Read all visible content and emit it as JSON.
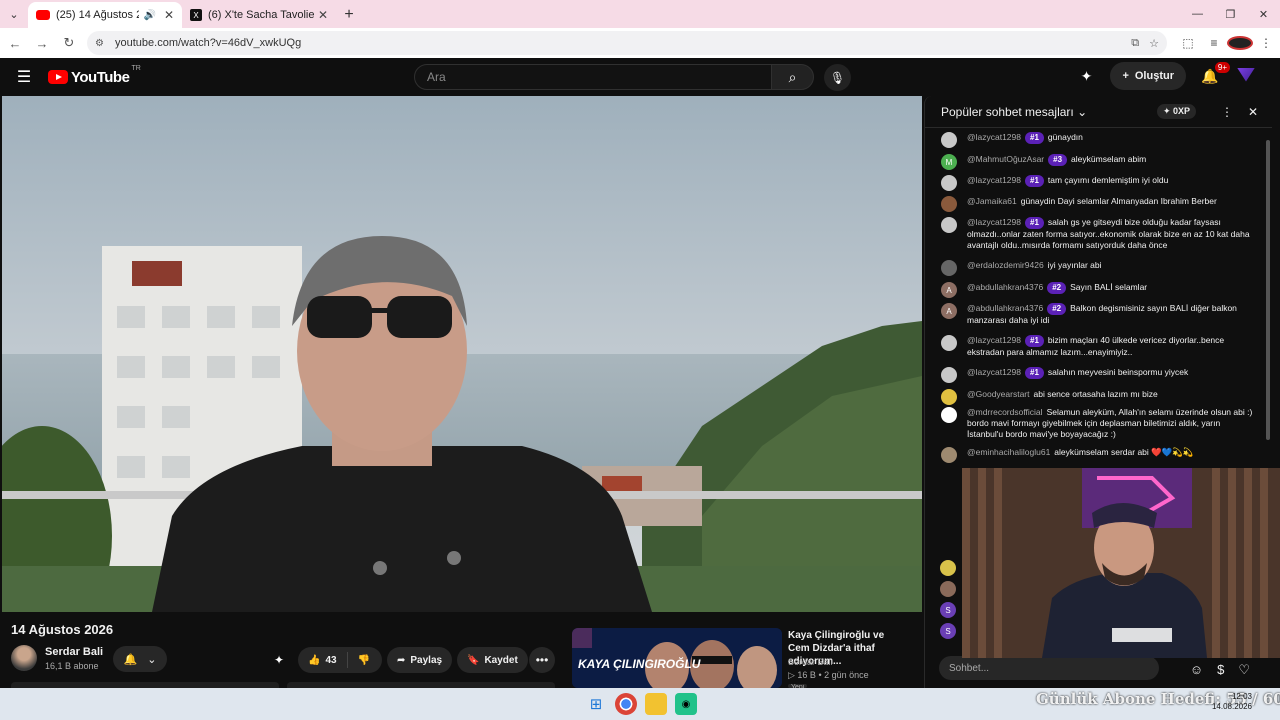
{
  "browser": {
    "tabs": [
      {
        "title": "(25) 14 Ağustos 2026 - You",
        "active": true
      },
      {
        "title": "(6) X'te Sacha Tavolieri: \"",
        "active": false
      }
    ],
    "url": "youtube.com/watch?v=46dV_xwkUQg"
  },
  "youtube": {
    "logo": "YouTube",
    "country": "TR",
    "search_placeholder": "Ara",
    "create_label": "Oluştur",
    "notification_count": "9+"
  },
  "video": {
    "title": "14 Ağustos 2026",
    "channel": "Serdar Bali",
    "subscribers": "16,1 B abone",
    "likes": "43",
    "share_label": "Paylaş",
    "save_label": "Kaydet"
  },
  "recommendation": {
    "thumb_text": "KAYA ÇILINGIROĞLU",
    "title": "Kaya Çilingiroğlu ve Cem Dizdar'a ithaf ediyorum...",
    "channel": "Serdar Bali",
    "views": "16 B",
    "age": "2 gün önce",
    "badge": "Yeni"
  },
  "chat": {
    "header_title": "Popüler sohbet mesajları",
    "xp_label": "0XP",
    "input_placeholder": "Sohbet...",
    "messages": [
      {
        "author": "@lazycat1298",
        "badge": "#1",
        "text": "günaydın",
        "color": "#c8c8c8"
      },
      {
        "author": "@MahmutOğuzAsar",
        "badge": "#3",
        "text": "aleykümselam abim",
        "color": "#4caf50",
        "initial": "M"
      },
      {
        "author": "@lazycat1298",
        "badge": "#1",
        "text": "tam çayımı demlemiştim iyi oldu",
        "color": "#c8c8c8"
      },
      {
        "author": "@Jamaika61",
        "badge": "",
        "text": "günaydin Dayi selamlar Almanyadan Ibrahim Berber",
        "color": "#8a5a3c"
      },
      {
        "author": "@lazycat1298",
        "badge": "#1",
        "text": "salah gs ye gitseydi bize olduğu kadar faysası olmazdı..onlar zaten forma satıyor..ekonomik olarak bize en az 10 kat daha avantajlı oldu..mısırda formamı satıyorduk daha önce",
        "color": "#c8c8c8"
      },
      {
        "author": "@erdalozdemir9426",
        "badge": "",
        "text": "iyi yayınlar abi",
        "color": "#666"
      },
      {
        "author": "@abdullahkran4376",
        "badge": "#2",
        "text": "Sayın BALİ selamlar",
        "color": "#8d6e63",
        "initial": "A"
      },
      {
        "author": "@abdullahkran4376",
        "badge": "#2",
        "text": "Balkon degismisiniz sayın BALİ diğer balkon manzarası daha iyi idi",
        "color": "#8d6e63",
        "initial": "A"
      },
      {
        "author": "@lazycat1298",
        "badge": "#1",
        "text": "bizim maçları 40 ülkede vericez diyorlar..bence ekstradan para almamız lazım...enayimiyiz..",
        "color": "#c8c8c8"
      },
      {
        "author": "@lazycat1298",
        "badge": "#1",
        "text": "salahın meyvesini beinspormu yiycek",
        "color": "#c8c8c8"
      },
      {
        "author": "@Goodyearstart",
        "badge": "",
        "text": "abi sence ortasaha lazım mı bize",
        "color": "#e0c040"
      },
      {
        "author": "@mdrrecordsofficial",
        "badge": "",
        "text": "Selamun aleyküm, Allah'ın selamı üzerinde olsun abi :) bordo mavi formayı giyebilmek için deplasman biletimizi aldık, yarın İstanbul'u bordo mavi'ye boyayacağız :)",
        "color": "#ffffff"
      },
      {
        "author": "@eminhacihaliloglu61",
        "badge": "",
        "text": "aleykümselam serdar abi ❤️💙💫💫",
        "color": "#9e8a70"
      }
    ],
    "side_avatars": [
      "",
      "",
      "S",
      "S"
    ]
  },
  "overlay": {
    "goal_text": "Günlük Abone Hedefi: 55 / 60",
    "time": "12:03",
    "date": "14.08.2026"
  }
}
